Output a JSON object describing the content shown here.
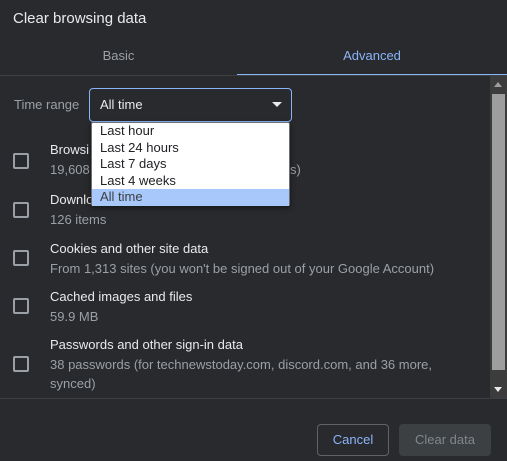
{
  "dialog": {
    "title": "Clear browsing data"
  },
  "tabs": [
    {
      "label": "Basic",
      "active": false
    },
    {
      "label": "Advanced",
      "active": true
    }
  ],
  "time_range": {
    "label": "Time range",
    "selected": "All time",
    "options": [
      "Last hour",
      "Last 24 hours",
      "Last 7 days",
      "Last 4 weeks",
      "All time"
    ]
  },
  "items": [
    {
      "title": "Browsi",
      "detail": "19,608",
      "detail_tail": "s)",
      "checked": false
    },
    {
      "title": "Downlo",
      "detail": "126 items",
      "checked": false
    },
    {
      "title": "Cookies and other site data",
      "detail": "From 1,313 sites (you won't be signed out of your Google Account)",
      "checked": false
    },
    {
      "title": "Cached images and files",
      "detail": "59.9 MB",
      "checked": false
    },
    {
      "title": "Passwords and other sign-in data",
      "detail": "38 passwords (for technewstoday.com, discord.com, and 36 more,",
      "detail_line2": "synced)",
      "checked": false
    }
  ],
  "buttons": {
    "cancel": "Cancel",
    "clear": "Clear data"
  },
  "colors": {
    "background": "#292a2d",
    "accent": "#8ab4f8",
    "highlight": "#a8c7fa"
  }
}
